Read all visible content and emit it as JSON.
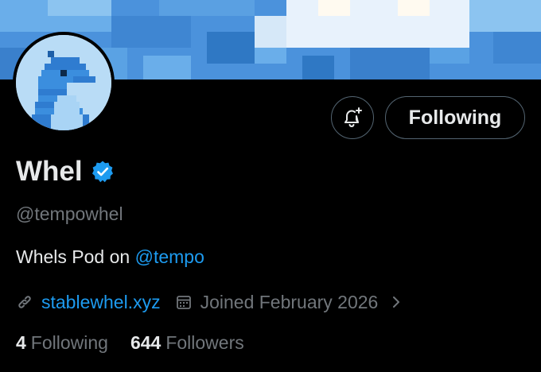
{
  "profile": {
    "display_name": "Whel",
    "handle": "@tempowhel",
    "bio_text": "Whels Pod on ",
    "bio_mention": "@tempo",
    "website": "stablewhel.xyz",
    "joined": "Joined February 2026",
    "following_count": "4",
    "following_label": "Following",
    "followers_count": "644",
    "followers_label": "Followers"
  },
  "actions": {
    "following_button_label": "Following"
  },
  "colors": {
    "background": "#000000",
    "accent": "#1d9bf0",
    "text_primary": "#e7e9ea",
    "text_secondary": "#71767b",
    "border": "#536471"
  },
  "icons": {
    "verified": "verified-badge-icon",
    "notify": "bell-plus-icon",
    "link": "link-icon",
    "calendar": "calendar-icon",
    "chevron": "chevron-right-icon"
  }
}
